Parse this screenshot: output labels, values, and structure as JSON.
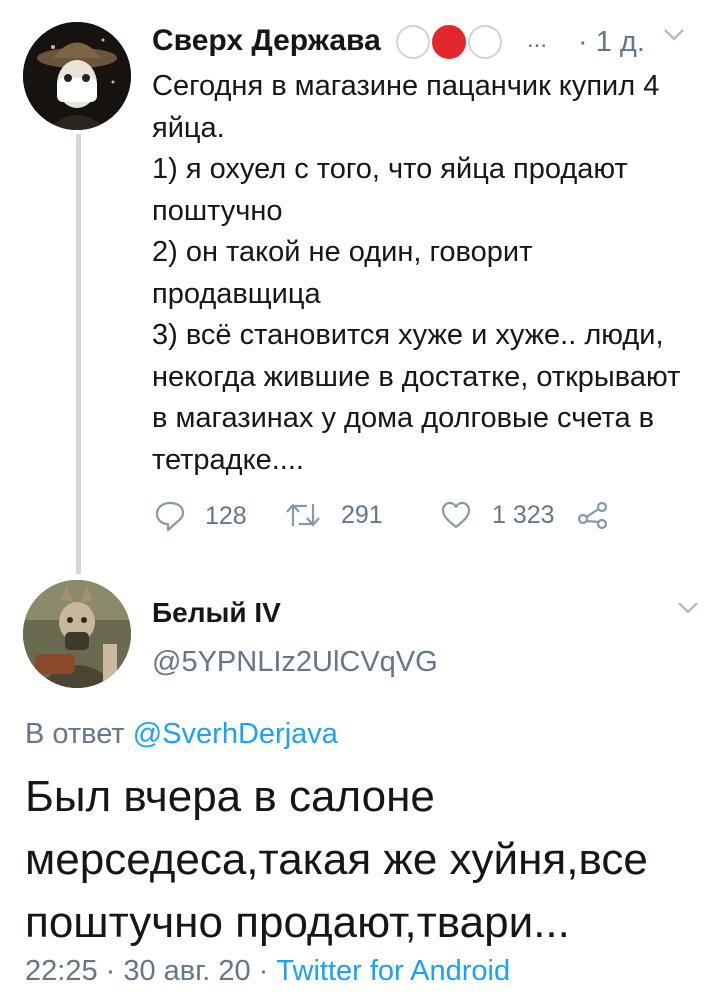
{
  "tweet": {
    "author_name": "Сверх Держава",
    "ellipsis": "...",
    "time": "· 1 д.",
    "lines": [
      "Сегодня в магазине пацанчик купил 4 яйца.",
      "1) я охуел с того, что яйца продают поштучно",
      "2) он такой не один, говорит продавщица",
      "3) всё становится хуже и хуже.. люди, некогда жившие в достатке, открывают в магазинах у дома долговые счета в тетрадке...."
    ],
    "replies": "128",
    "retweets": "291",
    "likes": "1 323"
  },
  "reply": {
    "author_name": "Белый IV",
    "handle": "@5YPNLIz2UlCVqVG",
    "in_reply_prefix": "В ответ",
    "in_reply_handle": "@SverhDerjava",
    "text": "Был вчера в салоне мерседеса,такая же хуйня,все поштучно продают,твари...",
    "timestamp": "22:25 · 30 авг. 20 ·",
    "source": "Twitter for Android"
  },
  "colors": {
    "text": "#14171a",
    "secondary": "#657786",
    "link": "#1da1f2",
    "badge_red": "#e2282c",
    "thread_line": "#cfd6dc"
  },
  "icons": [
    "reply-icon",
    "retweet-icon",
    "like-icon",
    "share-icon",
    "chevron-down-icon"
  ]
}
